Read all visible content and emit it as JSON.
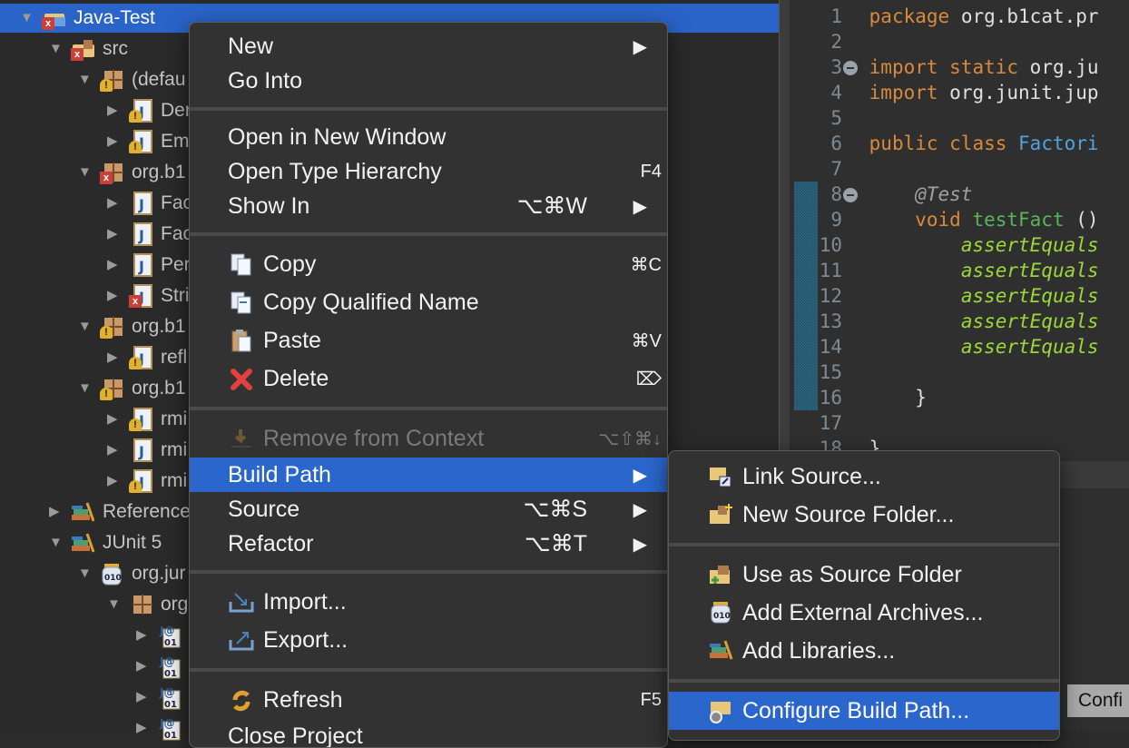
{
  "tree": [
    {
      "level": 0,
      "expanded": true,
      "label": "Java-Test",
      "icon": "project-icon",
      "badge": "error",
      "selected": true
    },
    {
      "level": 1,
      "expanded": true,
      "label": "src",
      "icon": "source-folder-icon",
      "badge": "error"
    },
    {
      "level": 2,
      "expanded": true,
      "label": "(defau",
      "icon": "package-icon",
      "badge": "warning"
    },
    {
      "level": 3,
      "expanded": false,
      "label": "Der",
      "icon": "java-file-icon",
      "badge": "warning"
    },
    {
      "level": 3,
      "expanded": false,
      "label": "Em",
      "icon": "java-file-icon",
      "badge": "warning"
    },
    {
      "level": 2,
      "expanded": true,
      "label": "org.b1",
      "icon": "package-icon",
      "badge": "error"
    },
    {
      "level": 3,
      "expanded": false,
      "label": "Fac",
      "icon": "java-file-icon",
      "badge": ""
    },
    {
      "level": 3,
      "expanded": false,
      "label": "Fac",
      "icon": "java-file-icon",
      "badge": ""
    },
    {
      "level": 3,
      "expanded": false,
      "label": "Per",
      "icon": "java-file-icon",
      "badge": ""
    },
    {
      "level": 3,
      "expanded": false,
      "label": "Stri",
      "icon": "java-file-icon",
      "badge": "error"
    },
    {
      "level": 2,
      "expanded": true,
      "label": "org.b1",
      "icon": "package-icon",
      "badge": "warning"
    },
    {
      "level": 3,
      "expanded": false,
      "label": "refl",
      "icon": "java-file-icon",
      "badge": "warning"
    },
    {
      "level": 2,
      "expanded": true,
      "label": "org.b1",
      "icon": "package-icon",
      "badge": "warning"
    },
    {
      "level": 3,
      "expanded": false,
      "label": "rmi",
      "icon": "java-file-icon",
      "badge": "warning"
    },
    {
      "level": 3,
      "expanded": false,
      "label": "rmi",
      "icon": "java-file-icon",
      "badge": ""
    },
    {
      "level": 3,
      "expanded": false,
      "label": "rmi",
      "icon": "java-file-icon",
      "badge": "warning"
    },
    {
      "level": 1,
      "expanded": false,
      "label": "Reference",
      "icon": "library-icon",
      "badge": ""
    },
    {
      "level": 1,
      "expanded": true,
      "label": "JUnit 5",
      "icon": "library-icon",
      "badge": ""
    },
    {
      "level": 2,
      "expanded": true,
      "label": "org.jur",
      "icon": "jar-icon",
      "badge": ""
    },
    {
      "level": 3,
      "expanded": true,
      "label": "org",
      "icon": "package-icon",
      "badge": ""
    },
    {
      "level": 4,
      "expanded": false,
      "label": "",
      "icon": "class-file-icon",
      "badge": ""
    },
    {
      "level": 4,
      "expanded": false,
      "label": "",
      "icon": "class-file-icon",
      "badge": ""
    },
    {
      "level": 4,
      "expanded": false,
      "label": "",
      "icon": "class-file-icon",
      "badge": ""
    },
    {
      "level": 4,
      "expanded": false,
      "label": "",
      "icon": "class-file-icon",
      "badge": ""
    }
  ],
  "editor": {
    "lines": [
      {
        "n": "1",
        "fold": false,
        "tokens": [
          [
            "kw",
            "package"
          ],
          [
            "",
            "org.b1cat.pr"
          ]
        ]
      },
      {
        "n": "2",
        "fold": false,
        "tokens": []
      },
      {
        "n": "3",
        "fold": true,
        "tokens": [
          [
            "kw",
            "import static"
          ],
          [
            "",
            "org.ju"
          ]
        ]
      },
      {
        "n": "4",
        "fold": false,
        "tokens": [
          [
            "kw",
            "import"
          ],
          [
            "",
            "org.junit.jup"
          ]
        ]
      },
      {
        "n": "5",
        "fold": false,
        "tokens": []
      },
      {
        "n": "6",
        "fold": false,
        "tokens": [
          [
            "kw",
            "public class"
          ],
          [
            "cls",
            "Factori"
          ]
        ]
      },
      {
        "n": "7",
        "fold": false,
        "tokens": []
      },
      {
        "n": "8",
        "fold": true,
        "tokens": [
          [
            "",
            "    "
          ],
          [
            "ann",
            "@Test"
          ]
        ]
      },
      {
        "n": "9",
        "fold": false,
        "tokens": [
          [
            "",
            "    "
          ],
          [
            "kw",
            "void"
          ],
          [
            "fn",
            "testFact"
          ],
          [
            "",
            "()"
          ]
        ]
      },
      {
        "n": "10",
        "fold": false,
        "tokens": [
          [
            "",
            "        "
          ],
          [
            "st",
            "assertEquals"
          ]
        ]
      },
      {
        "n": "11",
        "fold": false,
        "tokens": [
          [
            "",
            "        "
          ],
          [
            "st",
            "assertEquals"
          ]
        ]
      },
      {
        "n": "12",
        "fold": false,
        "tokens": [
          [
            "",
            "        "
          ],
          [
            "st",
            "assertEquals"
          ]
        ]
      },
      {
        "n": "13",
        "fold": false,
        "tokens": [
          [
            "",
            "        "
          ],
          [
            "st",
            "assertEquals"
          ]
        ]
      },
      {
        "n": "14",
        "fold": false,
        "tokens": [
          [
            "",
            "        "
          ],
          [
            "st",
            "assertEquals"
          ]
        ]
      },
      {
        "n": "15",
        "fold": false,
        "tokens": []
      },
      {
        "n": "16",
        "fold": false,
        "tokens": [
          [
            "",
            "    }"
          ]
        ]
      },
      {
        "n": "17",
        "fold": false,
        "tokens": []
      },
      {
        "n": "18",
        "fold": false,
        "tokens": [
          [
            "",
            "}"
          ]
        ]
      }
    ]
  },
  "context_menu": [
    {
      "label": "New",
      "arrow": true
    },
    {
      "label": "Go Into"
    },
    {
      "sep": true
    },
    {
      "label": "Open in New Window"
    },
    {
      "label": "Open Type Hierarchy",
      "shortcut": "F4",
      "far": true
    },
    {
      "label": "Show In",
      "shortcut": "⌥⌘W",
      "arrow": true
    },
    {
      "sep": true
    },
    {
      "label": "Copy",
      "icon": "copy-icon",
      "shortcut": "⌘C",
      "far": true
    },
    {
      "label": "Copy Qualified Name",
      "icon": "copy-qualified-name-icon"
    },
    {
      "label": "Paste",
      "icon": "paste-icon",
      "shortcut": "⌘V",
      "far": true
    },
    {
      "label": "Delete",
      "icon": "delete-icon",
      "shortcut": "⌦",
      "far": true
    },
    {
      "sep": true
    },
    {
      "label": "Remove from Context",
      "icon": "remove-context-icon",
      "shortcut": "⌥⇧⌘↓",
      "far": true,
      "disabled": true
    },
    {
      "label": "Build Path",
      "arrow": true,
      "highlighted": true
    },
    {
      "label": "Source",
      "shortcut": "⌥⌘S",
      "arrow": true
    },
    {
      "label": "Refactor",
      "shortcut": "⌥⌘T",
      "arrow": true
    },
    {
      "sep": true
    },
    {
      "label": "Import...",
      "icon": "import-icon"
    },
    {
      "label": "Export...",
      "icon": "export-icon"
    },
    {
      "sep": true
    },
    {
      "label": "Refresh",
      "icon": "refresh-icon",
      "shortcut": "F5",
      "far": true
    },
    {
      "label": "Close Project"
    }
  ],
  "build_path_menu": [
    {
      "label": "Link Source...",
      "icon": "link-source-icon"
    },
    {
      "label": "New Source Folder...",
      "icon": "new-source-folder-icon"
    },
    {
      "sep": true
    },
    {
      "label": "Use as Source Folder",
      "icon": "use-as-source-folder-icon"
    },
    {
      "label": "Add External Archives...",
      "icon": "jar-icon"
    },
    {
      "label": "Add Libraries...",
      "icon": "library-icon"
    },
    {
      "sep": true
    },
    {
      "label": "Configure Build Path...",
      "icon": "configure-build-path-icon",
      "highlighted": true
    }
  ],
  "background_button": {
    "label": "Confi"
  },
  "colors": {
    "selection": "#2a64c8",
    "menu_bg": "#323232",
    "keyword": "#d88a3c",
    "string_method": "#9cd838"
  }
}
